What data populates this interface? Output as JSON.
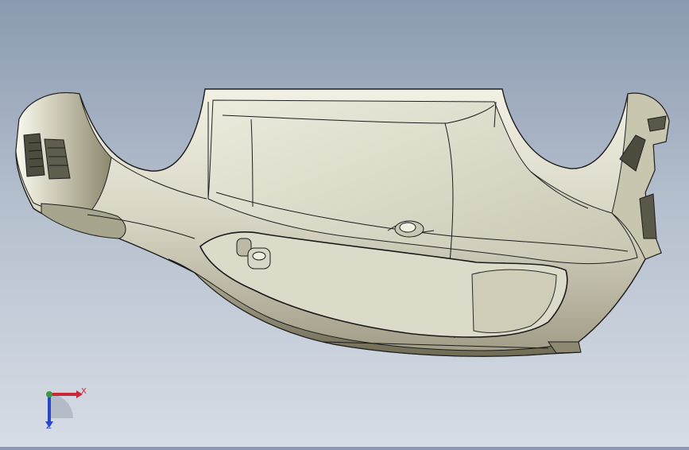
{
  "viewport": {
    "background_top": "#8b9ab0",
    "background_bottom": "#d7dde6",
    "part_fill": "#d9d8c8",
    "edge_color": "#1f1f1f"
  },
  "triad": {
    "x_label": "X",
    "z_label": "Z",
    "x_color": "#c8283c",
    "y_color": "#3c9b42",
    "z_color": "#2b47c9"
  }
}
